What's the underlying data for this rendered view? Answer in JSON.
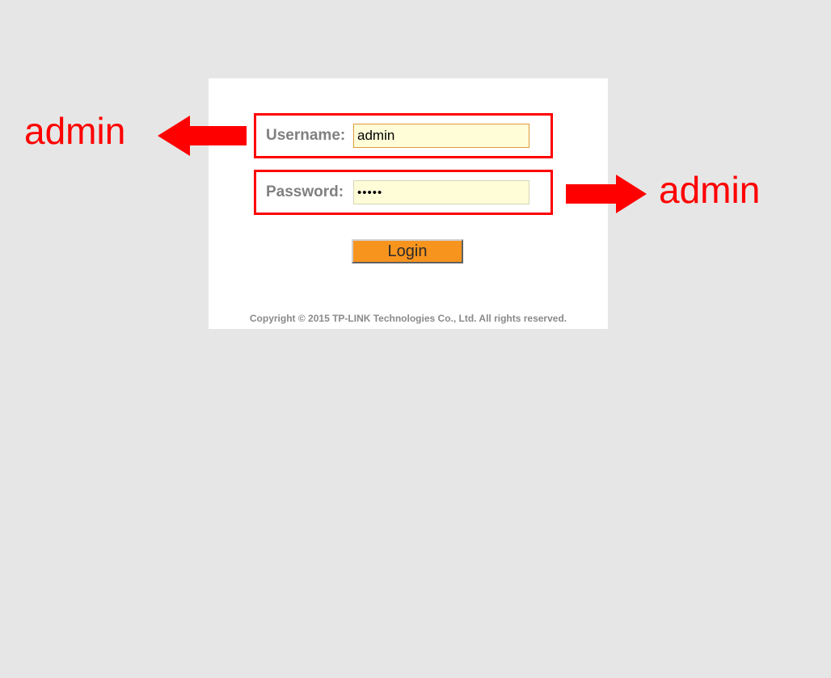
{
  "form": {
    "username_label": "Username:",
    "username_value": "admin",
    "password_label": "Password:",
    "password_value": "•••••",
    "login_button": "Login"
  },
  "footer": {
    "copyright": "Copyright © 2015 TP-LINK Technologies Co., Ltd. All rights reserved."
  },
  "annotations": {
    "left_label": "admin",
    "right_label": "admin"
  }
}
